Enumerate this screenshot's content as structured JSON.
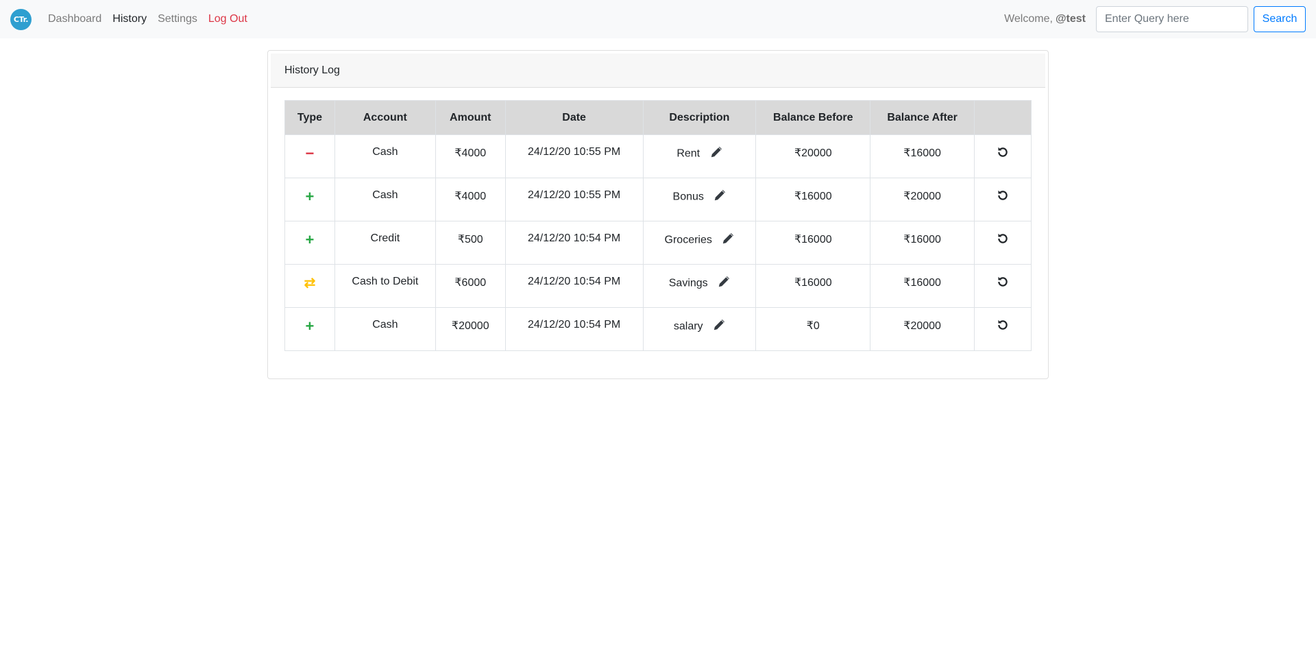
{
  "nav": {
    "logo_text": "CTr.",
    "links": [
      "Dashboard",
      "History",
      "Settings",
      "Log Out"
    ],
    "welcome_prefix": "Welcome,",
    "username": "@test",
    "search_placeholder": "Enter Query here",
    "search_label": "Search"
  },
  "card": {
    "title": "History Log"
  },
  "table": {
    "headers": [
      "Type",
      "Account",
      "Amount",
      "Date",
      "Description",
      "Balance Before",
      "Balance After",
      ""
    ],
    "rows": [
      {
        "type_icon": "minus-icon",
        "type_symbol": "−",
        "account": "Cash",
        "amount": "₹4000",
        "date": "24/12/20 10:55 PM",
        "description": "Rent",
        "balance_before": "₹20000",
        "balance_after": "₹16000"
      },
      {
        "type_icon": "plus-icon",
        "type_symbol": "+",
        "account": "Cash",
        "amount": "₹4000",
        "date": "24/12/20 10:55 PM",
        "description": "Bonus",
        "balance_before": "₹16000",
        "balance_after": "₹20000"
      },
      {
        "type_icon": "plus-icon",
        "type_symbol": "+",
        "account": "Credit",
        "amount": "₹500",
        "date": "24/12/20 10:54 PM",
        "description": "Groceries",
        "balance_before": "₹16000",
        "balance_after": "₹16000"
      },
      {
        "type_icon": "transfer-icon",
        "type_symbol": "⇄",
        "account": "Cash to Debit",
        "amount": "₹6000",
        "date": "24/12/20 10:54 PM",
        "description": "Savings",
        "balance_before": "₹16000",
        "balance_after": "₹16000"
      },
      {
        "type_icon": "plus-icon",
        "type_symbol": "+",
        "account": "Cash",
        "amount": "₹20000",
        "date": "24/12/20 10:54 PM",
        "description": "salary",
        "balance_before": "₹0",
        "balance_after": "₹20000"
      }
    ]
  },
  "colors": {
    "minus": "#dc3545",
    "plus": "#28a745",
    "transfer": "#ffc107",
    "primary": "#007bff",
    "logo": "#2f9fd0"
  }
}
